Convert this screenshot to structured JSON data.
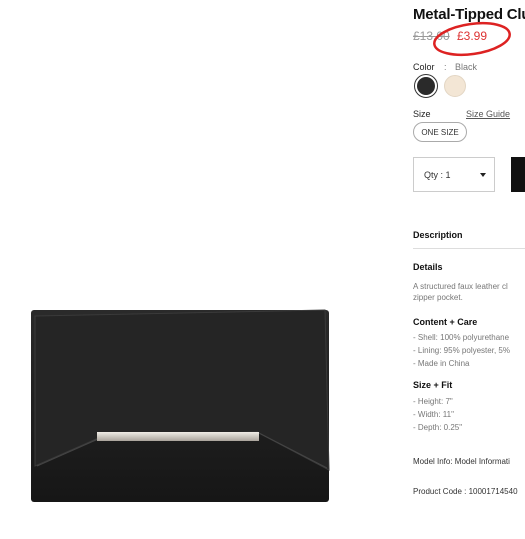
{
  "product": {
    "title": "Metal-Tipped Clu",
    "old_price": "£13.00",
    "new_price": "£3.99"
  },
  "color": {
    "label": "Color",
    "separator": ":",
    "value": "Black",
    "swatches": [
      {
        "name": "black",
        "hex": "#2a2a2a"
      },
      {
        "name": "cream",
        "hex": "#f3e6d5"
      }
    ]
  },
  "size": {
    "label": "Size",
    "guide": "Size Guide",
    "option": "ONE SIZE"
  },
  "qty": {
    "label": "Qty : 1"
  },
  "description": {
    "heading": "Description"
  },
  "details": {
    "heading": "Details",
    "lines": [
      "A structured faux leather cl",
      "zipper pocket."
    ]
  },
  "content_care": {
    "heading": "Content + Care",
    "lines": [
      "- Shell: 100% polyurethane",
      "- Lining: 95% polyester, 5%",
      "- Made in China"
    ]
  },
  "size_fit": {
    "heading": "Size + Fit",
    "lines": [
      "- Height: 7\"",
      "- Width: 11\"",
      "- Depth: 0.25\""
    ]
  },
  "model_info": "Model Info: Model Informati",
  "product_code": "Product Code : 10001714540",
  "colors": {
    "accent_red": "#dd2222",
    "bag": "#1e1e1e",
    "bar": "#cfcac4"
  }
}
